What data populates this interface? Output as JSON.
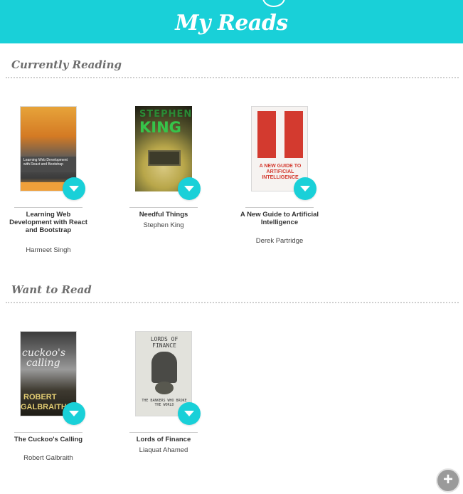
{
  "header": {
    "title": "My Reads"
  },
  "shelves": [
    {
      "title": "Currently Reading",
      "books": [
        {
          "title": "Learning Web Development with React and Bootstrap",
          "authors": "Harmeet Singh",
          "cover_text": "Learning Web Development with React and Bootstrap"
        },
        {
          "title": "Needful Things",
          "authors": "Stephen King",
          "cover_text_1": "STEPHEN",
          "cover_text_2": "KING"
        },
        {
          "title": "A New Guide to Artificial Intelligence",
          "authors": "Derek Partridge",
          "cover_text": "A NEW GUIDE TO ARTIFICIAL INTELLIGENCE"
        }
      ]
    },
    {
      "title": "Want to Read",
      "books": [
        {
          "title": "The Cuckoo's Calling",
          "authors": "Robert Galbraith",
          "cover_text_1": "cuckoo's",
          "cover_text_2": "calling",
          "cover_text_3": "ROBERT",
          "cover_text_4": "GALBRAITH"
        },
        {
          "title": "Lords of Finance",
          "authors": "Liaquat Ahamed",
          "cover_text": "LORDS OF FINANCE",
          "cover_text_2": "THE BANKERS WHO BROKE THE WORLD"
        }
      ]
    }
  ],
  "actions": {
    "add_label": "+"
  },
  "colors": {
    "accent": "#19d0d8",
    "header_text": "#ffffff",
    "shelf_title": "#6e6e6e"
  },
  "icons": {
    "shelf_changer": "triangle-down-icon",
    "add": "plus-icon"
  }
}
